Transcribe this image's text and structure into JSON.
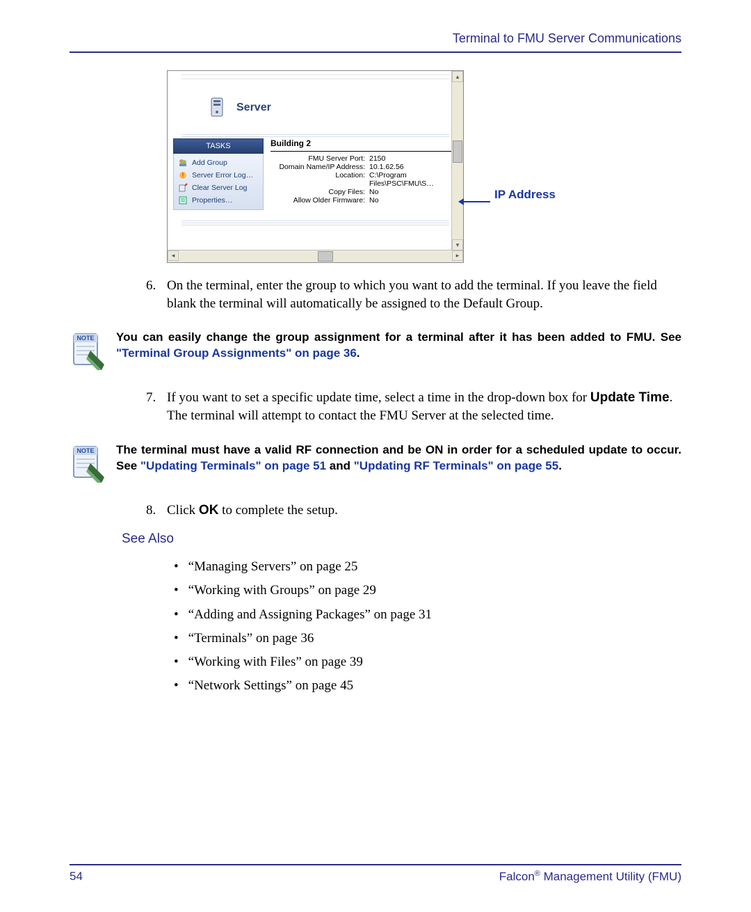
{
  "header": {
    "title": "Terminal to FMU Server Communications"
  },
  "screenshot": {
    "serverTitle": "Server",
    "tasksHeader": "TASKS",
    "tasks": [
      {
        "icon": "user-group-icon",
        "label": "Add Group"
      },
      {
        "icon": "error-log-icon",
        "label": "Server Error Log…"
      },
      {
        "icon": "clear-log-icon",
        "label": "Clear Server Log"
      },
      {
        "icon": "properties-icon",
        "label": "Properties…"
      }
    ],
    "detailsTitle": "Building 2",
    "details": [
      {
        "k": "FMU Server Port:",
        "v": "2150"
      },
      {
        "k": "Domain Name/IP Address:",
        "v": "10.1.62.56"
      },
      {
        "k": "Location:",
        "v": "C:\\Program Files\\PSC\\FMU\\S…"
      },
      {
        "k": "Copy Files:",
        "v": "No"
      },
      {
        "k": "Allow Older Firmware:",
        "v": "No"
      }
    ]
  },
  "callout": {
    "label": "IP Address"
  },
  "steps": {
    "s6_n": "6.",
    "s6_t": "On the terminal, enter the group to which you want to add the terminal. If you leave the field blank the terminal will automatically be assigned to the Default Group.",
    "s7_n": "7.",
    "s7_a": "If you want to set a specific update time, select a time in the drop-down box for ",
    "s7_b": "Update Time",
    "s7_c": ". The terminal will attempt to contact the FMU Server at the selected time.",
    "s8_n": "8.",
    "s8_a": "Click ",
    "s8_b": "OK",
    "s8_c": " to complete the setup."
  },
  "note1": {
    "a": "You can easily change the group assignment for a terminal after it has been added to FMU. See ",
    "b": "\"Terminal Group Assignments\" on page 36",
    "c": "."
  },
  "note2": {
    "a": "The terminal must have a valid RF connection and be ON in order for a scheduled update to occur. See ",
    "b": "\"Updating Terminals\" on page 51",
    "c": " and ",
    "d": "\"Updating RF Terminals\" on page 55",
    "e": "."
  },
  "seeAlso": {
    "title": "See Also",
    "items": [
      "“Managing Servers” on page 25",
      "“Working with Groups” on page 29",
      "“Adding and Assigning Packages” on page 31",
      "“Terminals” on page 36",
      "“Working with Files” on page 39",
      "“Network Settings” on page 45"
    ]
  },
  "footer": {
    "page": "54",
    "product_a": "Falcon",
    "product_b": " Management Utility (FMU)"
  },
  "chart_data": {
    "type": "table",
    "title": "Building 2",
    "rows": [
      {
        "property": "FMU Server Port",
        "value": "2150"
      },
      {
        "property": "Domain Name/IP Address",
        "value": "10.1.62.56"
      },
      {
        "property": "Location",
        "value": "C:\\Program Files\\PSC\\FMU\\S…"
      },
      {
        "property": "Copy Files",
        "value": "No"
      },
      {
        "property": "Allow Older Firmware",
        "value": "No"
      }
    ]
  }
}
